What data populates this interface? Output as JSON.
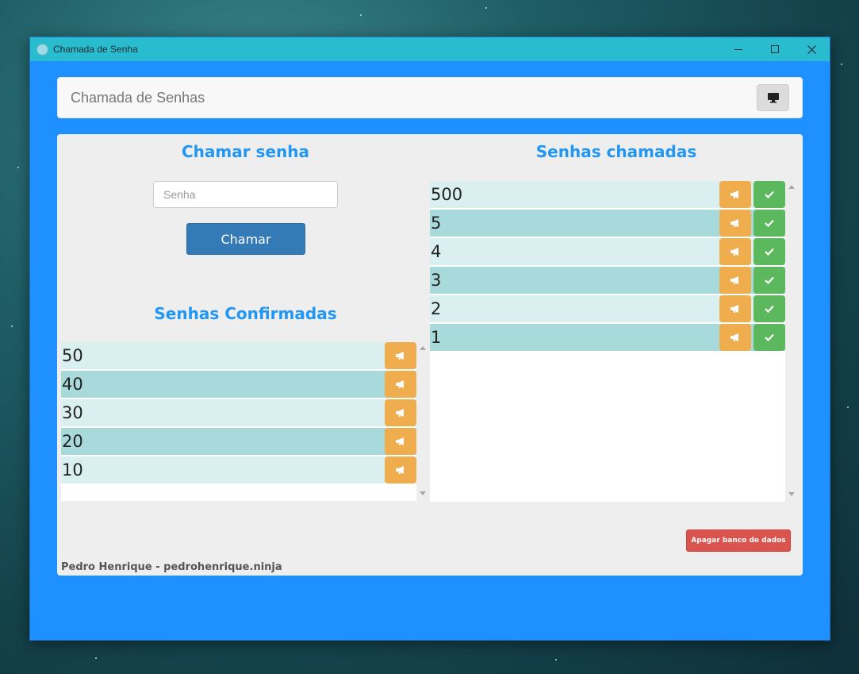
{
  "window": {
    "title": "Chamada de Senha"
  },
  "navbar": {
    "brand": "Chamada de Senhas"
  },
  "call_section": {
    "heading": "Chamar senha",
    "input_placeholder": "Senha",
    "call_button": "Chamar"
  },
  "confirmed_section": {
    "heading": "Senhas Confirmadas",
    "items": [
      "50",
      "40",
      "30",
      "20",
      "10"
    ]
  },
  "called_section": {
    "heading": "Senhas chamadas",
    "items": [
      "500",
      "5",
      "4",
      "3",
      "2",
      "1"
    ]
  },
  "delete_button": "Apagar banco de dados",
  "footer": "Pedro Henrique - pedrohenrique.ninja",
  "colors": {
    "accent": "#2196f3",
    "background": "#1e90ff",
    "titlebar": "#29bccf",
    "warning": "#f0ad4e",
    "success": "#5cb85c",
    "danger": "#d9534f",
    "primary": "#337ab7"
  },
  "icons": {
    "announce": "bullhorn-icon",
    "confirm": "check-icon",
    "display": "monitor-icon"
  }
}
